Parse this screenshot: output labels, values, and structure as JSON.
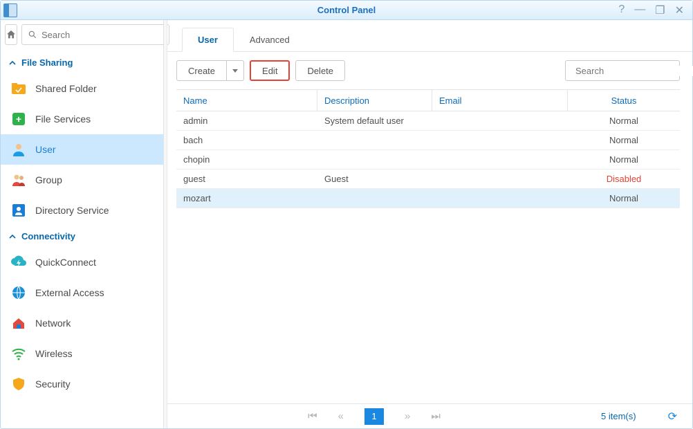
{
  "window": {
    "title": "Control Panel"
  },
  "sidebar": {
    "search_placeholder": "Search",
    "groups": [
      {
        "label": "File Sharing",
        "items": [
          {
            "id": "shared-folder",
            "label": "Shared Folder"
          },
          {
            "id": "file-services",
            "label": "File Services"
          },
          {
            "id": "user",
            "label": "User",
            "active": true
          },
          {
            "id": "group",
            "label": "Group"
          },
          {
            "id": "directory-service",
            "label": "Directory Service"
          }
        ]
      },
      {
        "label": "Connectivity",
        "items": [
          {
            "id": "quickconnect",
            "label": "QuickConnect"
          },
          {
            "id": "external-access",
            "label": "External Access"
          },
          {
            "id": "network",
            "label": "Network"
          },
          {
            "id": "wireless",
            "label": "Wireless"
          },
          {
            "id": "security",
            "label": "Security"
          }
        ]
      }
    ]
  },
  "tabs": [
    {
      "label": "User",
      "active": true
    },
    {
      "label": "Advanced"
    }
  ],
  "toolbar": {
    "create_label": "Create",
    "edit_label": "Edit",
    "delete_label": "Delete",
    "filter_placeholder": "Search"
  },
  "table": {
    "columns": {
      "name": "Name",
      "description": "Description",
      "email": "Email",
      "status": "Status"
    },
    "rows": [
      {
        "name": "admin",
        "description": "System default user",
        "email": "",
        "status": "Normal"
      },
      {
        "name": "bach",
        "description": "",
        "email": "",
        "status": "Normal"
      },
      {
        "name": "chopin",
        "description": "",
        "email": "",
        "status": "Normal"
      },
      {
        "name": "guest",
        "description": "Guest",
        "email": "",
        "status": "Disabled",
        "status_class": "status-disabled"
      },
      {
        "name": "mozart",
        "description": "",
        "email": "",
        "status": "Normal",
        "selected": true
      }
    ]
  },
  "pager": {
    "current": "1",
    "items_label": "5 item(s)"
  }
}
